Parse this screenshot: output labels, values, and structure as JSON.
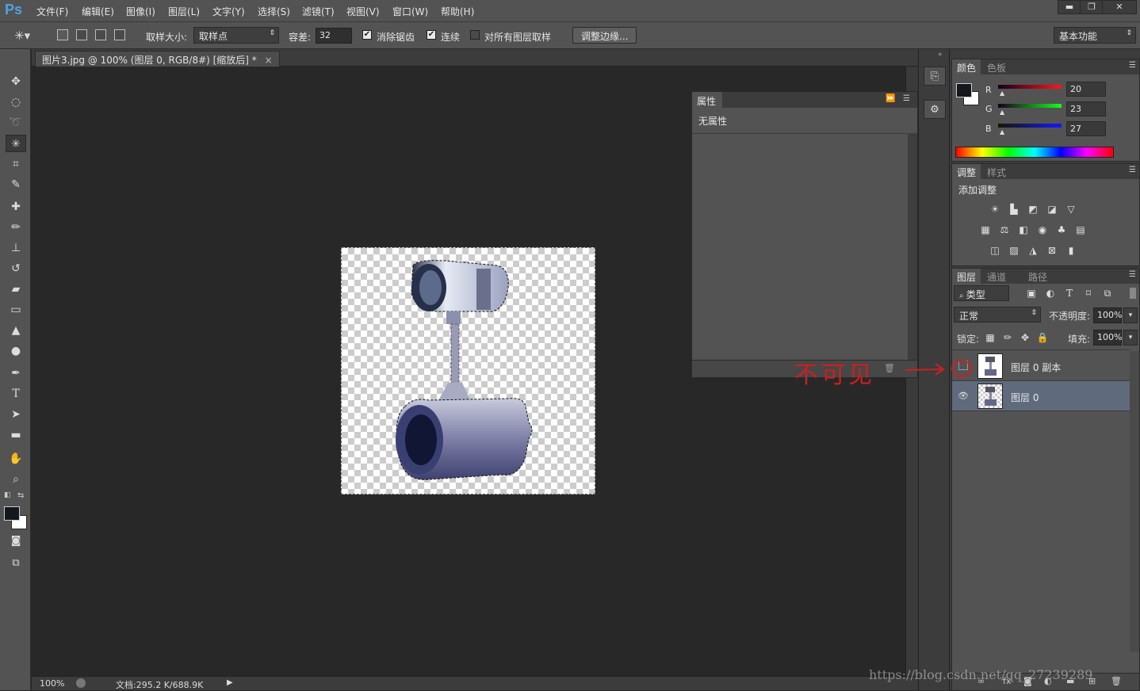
{
  "app": {
    "logo": "Ps"
  },
  "menu": [
    "文件(F)",
    "编辑(E)",
    "图像(I)",
    "图层(L)",
    "文字(Y)",
    "选择(S)",
    "滤镜(T)",
    "视图(V)",
    "窗口(W)",
    "帮助(H)"
  ],
  "window_controls": {
    "minimize": "▬",
    "restore": "❐",
    "close": "✕"
  },
  "options": {
    "sample_size_label": "取样大小:",
    "sample_size_value": "取样点",
    "tolerance_label": "容差:",
    "tolerance_value": "32",
    "antialias_label": "消除锯齿",
    "antialias_checked": true,
    "contiguous_label": "连续",
    "contiguous_checked": true,
    "sample_all_label": "对所有图层取样",
    "sample_all_checked": false,
    "refine_edge_button": "调整边缘...",
    "workspace_value": "基本功能"
  },
  "document": {
    "tab_title": "图片3.jpg @ 100% (图层 0, RGB/8#) [缩放后] *",
    "tab_close": "×",
    "zoom": "100%",
    "doc_size": "文档:295.2 K/688.9K"
  },
  "properties_panel": {
    "tab": "属性",
    "content": "无属性"
  },
  "color_panel": {
    "tabs": [
      "颜色",
      "色板"
    ],
    "r_label": "R",
    "r_value": "20",
    "g_label": "G",
    "g_value": "23",
    "b_label": "B",
    "b_value": "27",
    "foreground_color": "#14171b",
    "background_color": "#ffffff"
  },
  "adjustments_panel": {
    "tabs": [
      "调整",
      "样式"
    ],
    "title": "添加调整"
  },
  "layers_panel": {
    "tabs": [
      "图层",
      "通道",
      "路径"
    ],
    "filter_kind": "类型",
    "blend_mode": "正常",
    "opacity_label": "不透明度:",
    "opacity_value": "100%",
    "lock_label": "锁定:",
    "fill_label": "填充:",
    "fill_value": "100%",
    "layers": [
      {
        "name": "图层 0 副本",
        "visible": false
      },
      {
        "name": "图层 0",
        "visible": true,
        "selected": true
      }
    ]
  },
  "annotation": {
    "text": "不可见",
    "color": "#cc1f1f"
  },
  "watermark": "https://blog.csdn.net/qq_27239289"
}
